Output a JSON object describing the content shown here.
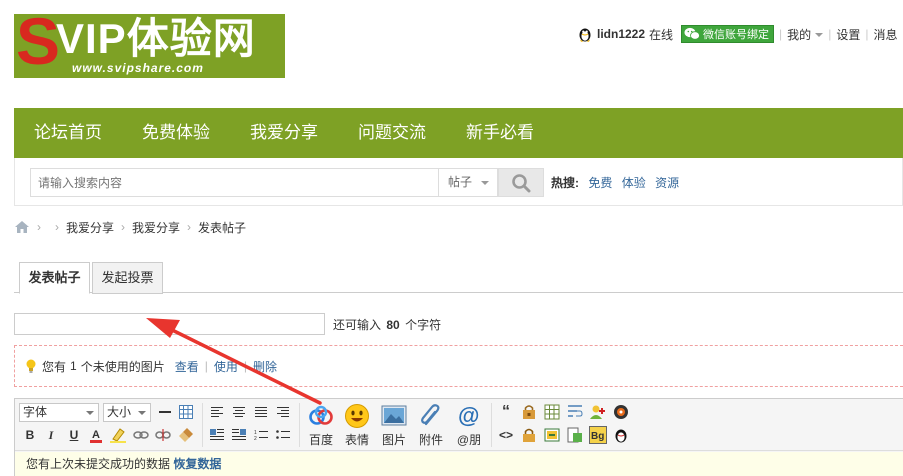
{
  "header": {
    "logo": {
      "s_letter": "S",
      "vip_text": "VIP体验网",
      "url_text": "www.svipshare.com"
    },
    "user": {
      "name": "lidn1222",
      "status": "在线",
      "wechat_bind": "微信账号绑定",
      "my": "我的",
      "settings": "设置",
      "messages": "消息"
    }
  },
  "nav": {
    "items": [
      {
        "label": "论坛首页"
      },
      {
        "label": "免费体验"
      },
      {
        "label": "我爱分享"
      },
      {
        "label": "问题交流"
      },
      {
        "label": "新手必看"
      }
    ]
  },
  "search": {
    "placeholder": "请输入搜索内容",
    "type_value": "帖子",
    "hot_label": "热搜:",
    "hot_links": [
      "免费",
      "体验",
      "资源"
    ]
  },
  "breadcrumb": {
    "items": [
      "我爱分享",
      "我爱分享",
      "发表帖子"
    ]
  },
  "tabs": [
    {
      "label": "发表帖子",
      "active": true
    },
    {
      "label": "发起投票",
      "active": false
    }
  ],
  "subject": {
    "value": "",
    "hint_prefix": "还可输入",
    "count": "80",
    "hint_suffix": "个字符"
  },
  "attach_notice": {
    "prefix": "您有",
    "count": "1",
    "suffix": "个未使用的图片",
    "view": "查看",
    "use": "使用",
    "delete": "删除"
  },
  "editor": {
    "font_select": "字体",
    "size_select": "大小",
    "big_buttons": [
      "百度",
      "表情",
      "图片",
      "附件",
      "@朋"
    ],
    "restore_text": "您有上次未提交成功的数据",
    "restore_link": "恢复数据"
  },
  "colors": {
    "brand_green": "#7ea125",
    "logo_red": "#d8281f",
    "link_blue": "#336699",
    "notice_border": "#f0a0a0"
  }
}
